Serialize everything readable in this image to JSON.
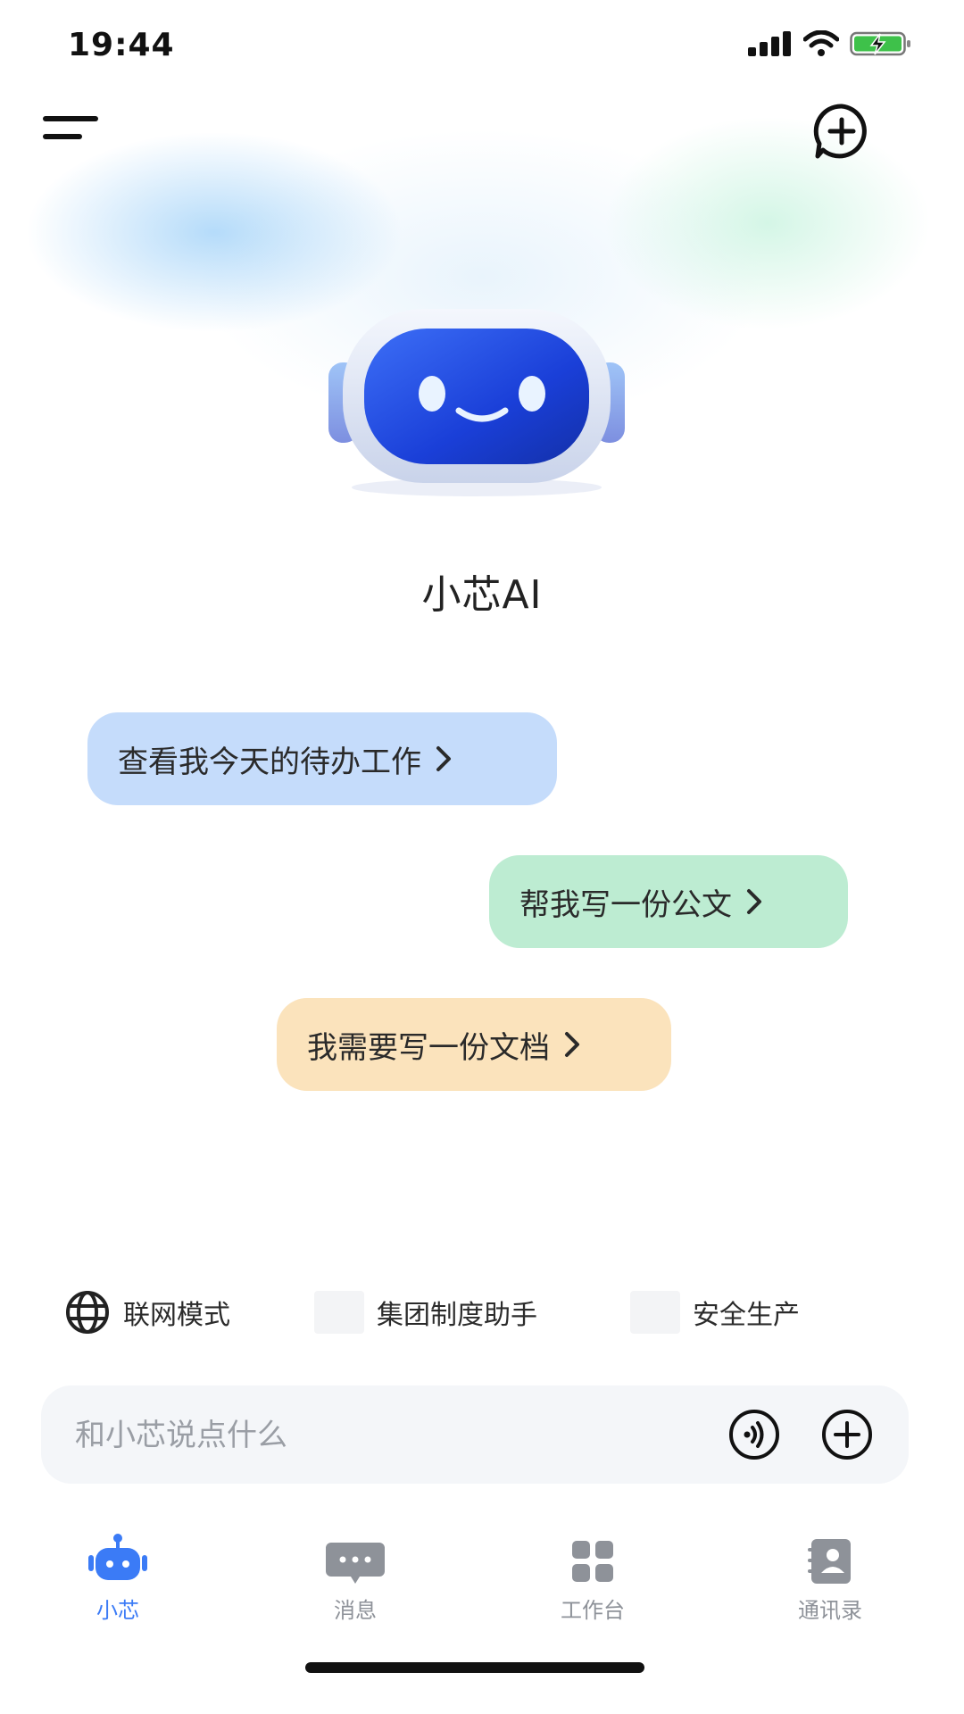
{
  "status_bar": {
    "time": "19:44",
    "icons": [
      "signal-icon",
      "wifi-icon",
      "battery-charging-icon"
    ]
  },
  "header": {
    "menu_icon": "menu-icon",
    "new_chat_icon": "new-chat-icon"
  },
  "assistant": {
    "avatar": "robot-avatar",
    "name": "小芯AI"
  },
  "suggestions": [
    {
      "label": "查看我今天的待办工作",
      "color": "#c5dcfb"
    },
    {
      "label": "帮我写一份公文",
      "color": "#bdecd2"
    },
    {
      "label": "我需要写一份文档",
      "color": "#fbe3bc"
    }
  ],
  "modes": [
    {
      "label": "联网模式",
      "icon": "globe-icon"
    },
    {
      "label": "集团制度助手",
      "icon": "placeholder-icon"
    },
    {
      "label": "安全生产",
      "icon": "placeholder-icon"
    }
  ],
  "input": {
    "placeholder": "和小芯说点什么",
    "value": "",
    "voice_icon": "voice-icon",
    "attach_icon": "plus-circle-icon"
  },
  "tabs": [
    {
      "label": "小芯",
      "icon": "robot-icon",
      "active": true
    },
    {
      "label": "消息",
      "icon": "chat-icon",
      "active": false
    },
    {
      "label": "工作台",
      "icon": "grid-icon",
      "active": false
    },
    {
      "label": "通讯录",
      "icon": "contacts-icon",
      "active": false
    }
  ],
  "colors": {
    "accent": "#3b7bf6",
    "inactive_tab": "#8e9299",
    "input_bg": "#f4f6f9"
  }
}
